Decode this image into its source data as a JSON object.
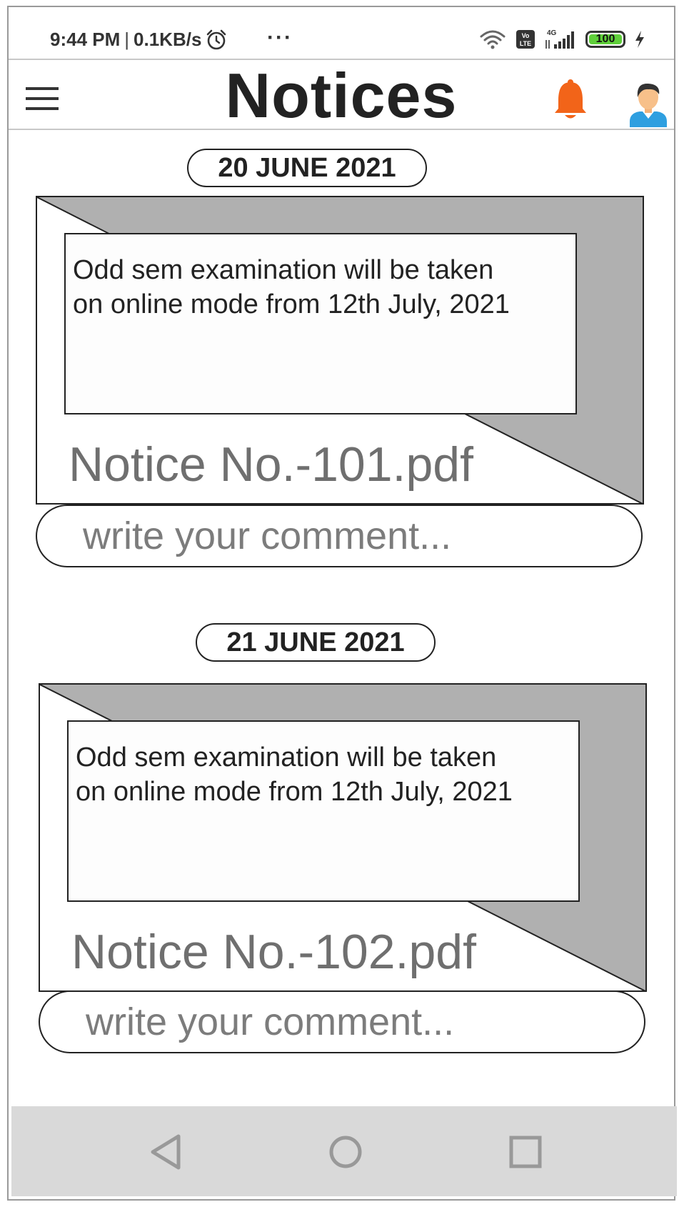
{
  "status_bar": {
    "time": "9:44 PM",
    "separator": "|",
    "speed": "0.1KB/s",
    "more": "···",
    "network_label": "4G",
    "volte_label": "Vo LTE",
    "battery_level": "100",
    "battery_color": "#5fcf3a"
  },
  "header": {
    "title": "Notices",
    "menu_icon": "hamburger-menu-icon",
    "bell_icon": "bell-icon",
    "bell_color": "#f26419",
    "avatar_icon": "user-avatar-icon"
  },
  "notices": [
    {
      "date": "20 JUNE 2021",
      "text_line1": "Odd sem examination will be taken",
      "text_line2": "on online mode from 12th July, 2021",
      "file": "Notice No.-101.pdf",
      "comment_placeholder": "write your comment..."
    },
    {
      "date": "21 JUNE 2021",
      "text_line1": "Odd sem examination will be taken",
      "text_line2": "on online mode from 12th July, 2021",
      "file": "Notice No.-102.pdf",
      "comment_placeholder": "write your comment..."
    }
  ],
  "nav_bar": {
    "back_icon": "back-triangle-icon",
    "home_icon": "home-circle-icon",
    "recents_icon": "recents-square-icon"
  },
  "colors": {
    "card_fold": "#b0b0b0",
    "placeholder": "#7c7c7c",
    "nav_bg": "#d9d9d9"
  }
}
